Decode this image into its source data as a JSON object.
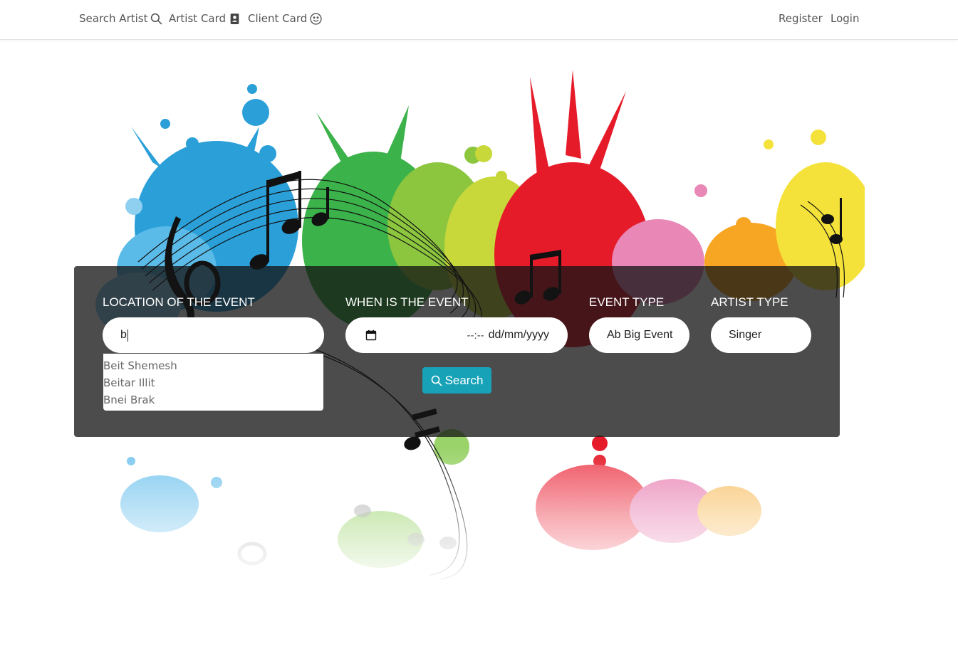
{
  "nav": {
    "search_artist": "Search Artist",
    "artist_card": "Artist Card",
    "client_card": "Client Card",
    "register": "Register",
    "login": "Login"
  },
  "form": {
    "location": {
      "label": "LOCATION OF THE EVENT",
      "value": "b"
    },
    "when": {
      "label": "WHEN IS THE EVENT",
      "time_placeholder": "--:--",
      "date_placeholder": "dd/mm/yyyy"
    },
    "event_type": {
      "label": "EVENT TYPE",
      "value": "Ab Big Event"
    },
    "artist_type": {
      "label": "ARTIST TYPE",
      "value": "Singer"
    },
    "suggestions": [
      "Beit Shemesh",
      "Beitar Illit",
      "Bnei Brak"
    ],
    "search_button": "Search"
  },
  "icons": {
    "search_artist": "search-icon",
    "artist_card": "contact-card-icon",
    "client_card": "smiley-icon",
    "date": "calendar-icon",
    "search_button": "search-icon"
  },
  "colors": {
    "panel_overlay": "#141414",
    "search_button": "#17a2b8",
    "nav_text": "#555555"
  }
}
